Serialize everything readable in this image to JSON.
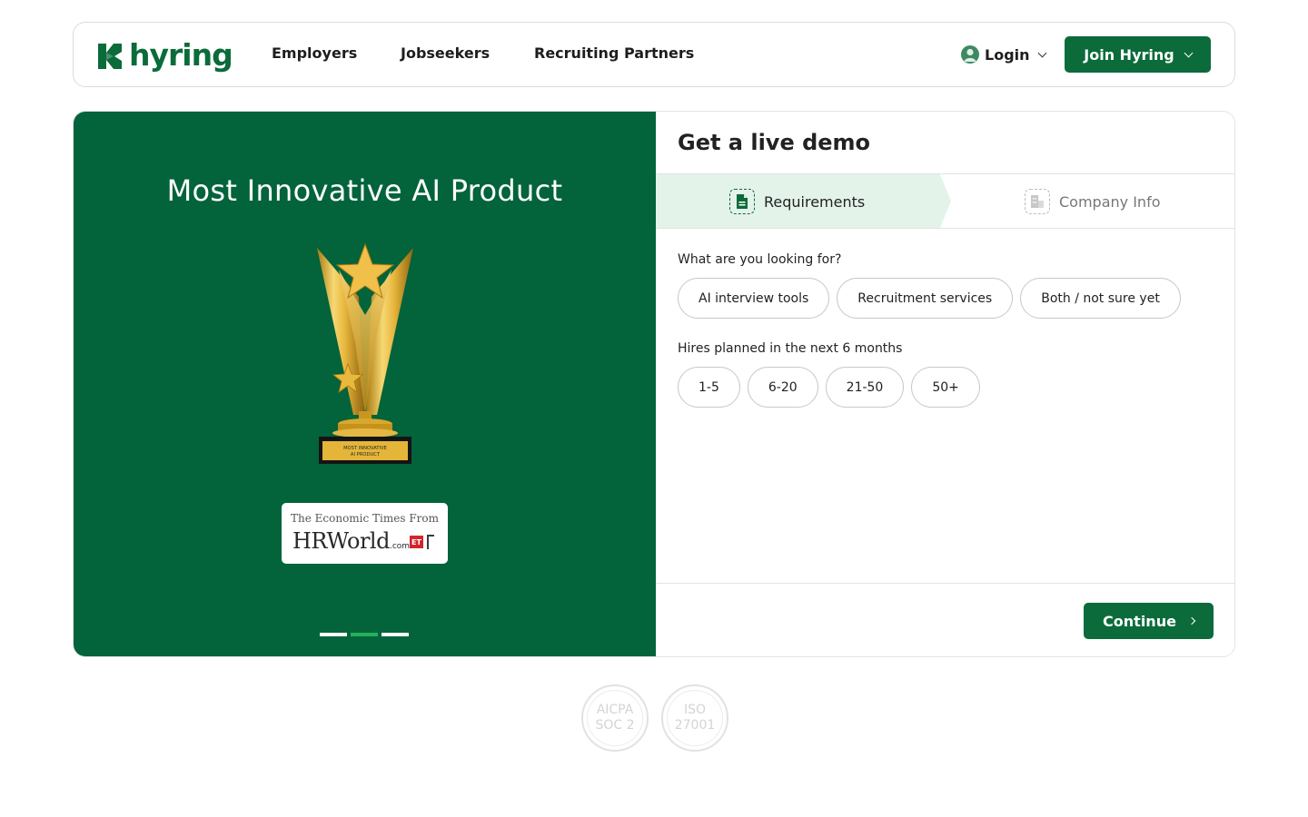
{
  "header": {
    "brand": "hyring",
    "nav": [
      "Employers",
      "Jobseekers",
      "Recruiting Partners"
    ],
    "login_label": "Login",
    "join_label": "Join Hyring"
  },
  "promo": {
    "title": "Most Innovative AI Product",
    "trophy_plate": "MOST INNOVATIVE AI PRODUCT",
    "badge_top": "The Economic Times  From",
    "badge_main": "HRWorld",
    "badge_suffix": ".com",
    "badge_logo": "ET",
    "slides": 3,
    "active_slide": 2
  },
  "form": {
    "title": "Get a live demo",
    "steps": [
      {
        "label": "Requirements",
        "icon": "document-icon",
        "active": true
      },
      {
        "label": "Company Info",
        "icon": "building-icon",
        "active": false
      }
    ],
    "question_1": {
      "label": "What are you looking for?",
      "options": [
        "AI interview tools",
        "Recruitment services",
        "Both / not sure yet"
      ]
    },
    "question_2": {
      "label": "Hires planned in the next 6 months",
      "options": [
        "1-5",
        "6-20",
        "21-50",
        "50+"
      ]
    },
    "continue_label": "Continue"
  },
  "certifications": [
    {
      "line1": "AICPA",
      "line2": "SOC 2"
    },
    {
      "line1": "ISO",
      "line2": "27001"
    }
  ],
  "colors": {
    "brand_green": "#0b6b3a",
    "promo_bg": "#03633b",
    "active_step_bg": "#e4f3ea",
    "active_dot": "#23b25a"
  }
}
